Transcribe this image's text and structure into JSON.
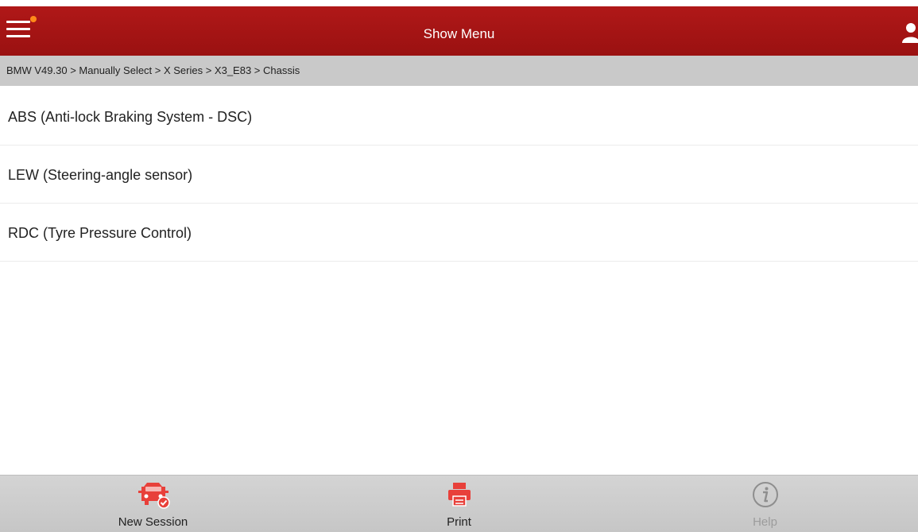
{
  "header": {
    "title": "Show Menu"
  },
  "breadcrumb": "BMW V49.30 > Manually Select > X Series > X3_E83 > Chassis",
  "systems": [
    "ABS (Anti-lock Braking System - DSC)",
    "LEW (Steering-angle sensor)",
    "RDC (Tyre Pressure Control)"
  ],
  "footer": {
    "new_session": "New Session",
    "print": "Print",
    "help": "Help"
  },
  "colors": {
    "header": "#a81515",
    "accent": "#e8403a",
    "notification_dot": "#ff8a1a",
    "breadcrumb_bg": "#c9c9c9",
    "footer_bg": "#cfcfcf",
    "disabled": "#9c9c9c"
  },
  "icons": {
    "menu": "hamburger-menu-icon",
    "user": "user-icon",
    "new_session": "car-icon",
    "print": "printer-icon",
    "help": "info-icon"
  }
}
